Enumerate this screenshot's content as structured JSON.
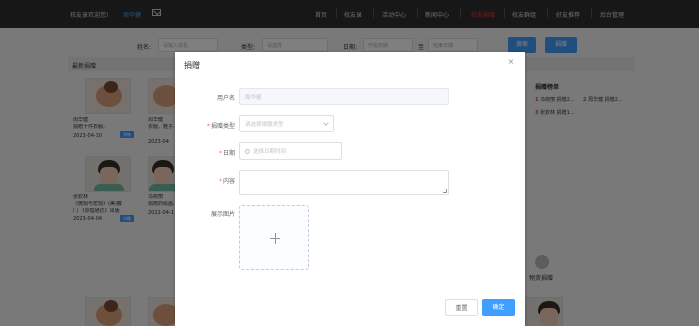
{
  "topbar": {
    "welcome": "校友录欢迎您!",
    "username": "周华健",
    "nav": [
      "首页",
      "校友录",
      "活动中心",
      "新闻中心",
      "校友捐赠",
      "校友群组",
      "好友推荐",
      "后台管理"
    ],
    "active_index": 4
  },
  "search": {
    "name_label": "姓名:",
    "name_placeholder": "请输入姓名",
    "type_label": "类型:",
    "type_placeholder": "请选择",
    "date_label": "日期:",
    "date_start": "开始日期",
    "date_to": "至",
    "date_end": "结束日期",
    "search_btn": "搜索",
    "donate_btn": "捐赠"
  },
  "list": {
    "title": "最新捐赠",
    "cards": [
      {
        "name": "周华健",
        "desc": "捐赠十件衣服。",
        "date": "2023-04-10",
        "tag": "衣物"
      },
      {
        "name": "周华健",
        "desc": "衣服、鞋子...",
        "date": "2023-04",
        "tag": ""
      },
      {
        "name": "张钦林",
        "desc": "《微观与宏观》(美)戴",
        "desc2": "门 《原理通达》出版",
        "date": "2023-04-04",
        "tag": "书籍"
      },
      {
        "name": "马晓丽",
        "desc": "捐赠的绘画...",
        "date": "2022-04-1",
        "tag": ""
      }
    ]
  },
  "rank": {
    "title": "捐赠榜单",
    "items": [
      {
        "num": "1",
        "text": "马晓丽 捐赠2..."
      },
      {
        "num": "2",
        "text": "周华健 捐赠2..."
      },
      {
        "num": "3",
        "text": "张钦林 捐赠1..."
      }
    ],
    "gift_label": "物资捐赠"
  },
  "dialog": {
    "title": "捐赠",
    "username_label": "用户名",
    "username_value": "周华健",
    "type_label": "捐赠类型",
    "type_placeholder": "请选择捐赠类型",
    "date_label": "日期",
    "date_placeholder": "选择日期时间",
    "content_label": "内容",
    "image_label": "展示图片",
    "reset_btn": "重置",
    "ok_btn": "确定"
  },
  "colors": {
    "primary": "#409eff",
    "danger": "#f56c6c",
    "topbar": "#2f2f2f"
  }
}
